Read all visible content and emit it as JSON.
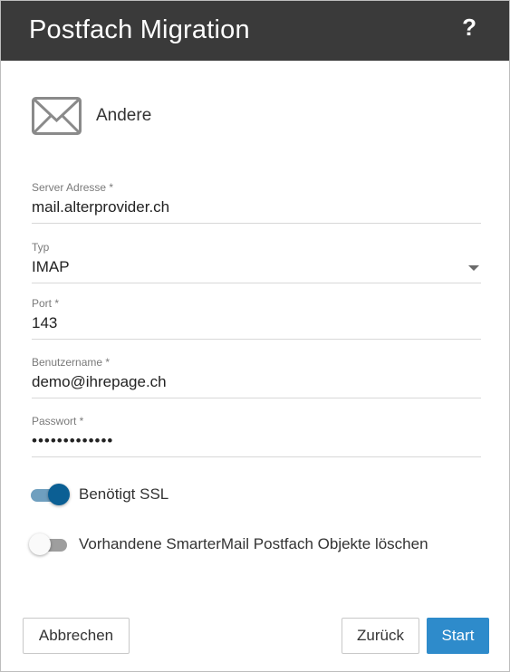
{
  "dialog": {
    "title": "Postfach Migration",
    "help_label": "?"
  },
  "provider": {
    "icon": "envelope-icon",
    "name": "Andere"
  },
  "fields": {
    "server": {
      "label": "Server Adresse *",
      "value": "mail.alterprovider.ch"
    },
    "type": {
      "label": "Typ",
      "value": "IMAP"
    },
    "port": {
      "label": "Port *",
      "value": "143"
    },
    "username": {
      "label": "Benutzername *",
      "value": "demo@ihrepage.ch"
    },
    "password": {
      "label": "Passwort *",
      "value": "•••••••••••••"
    }
  },
  "toggles": {
    "ssl": {
      "label": "Benötigt SSL",
      "on": true
    },
    "delete": {
      "label": "Vorhandene SmarterMail Postfach Objekte löschen",
      "on": false
    }
  },
  "buttons": {
    "cancel": "Abbrechen",
    "back": "Zurück",
    "start": "Start"
  },
  "colors": {
    "header_bg": "#3a3a3a",
    "primary": "#2e8bcb",
    "toggle_on": "#0b5f94"
  }
}
